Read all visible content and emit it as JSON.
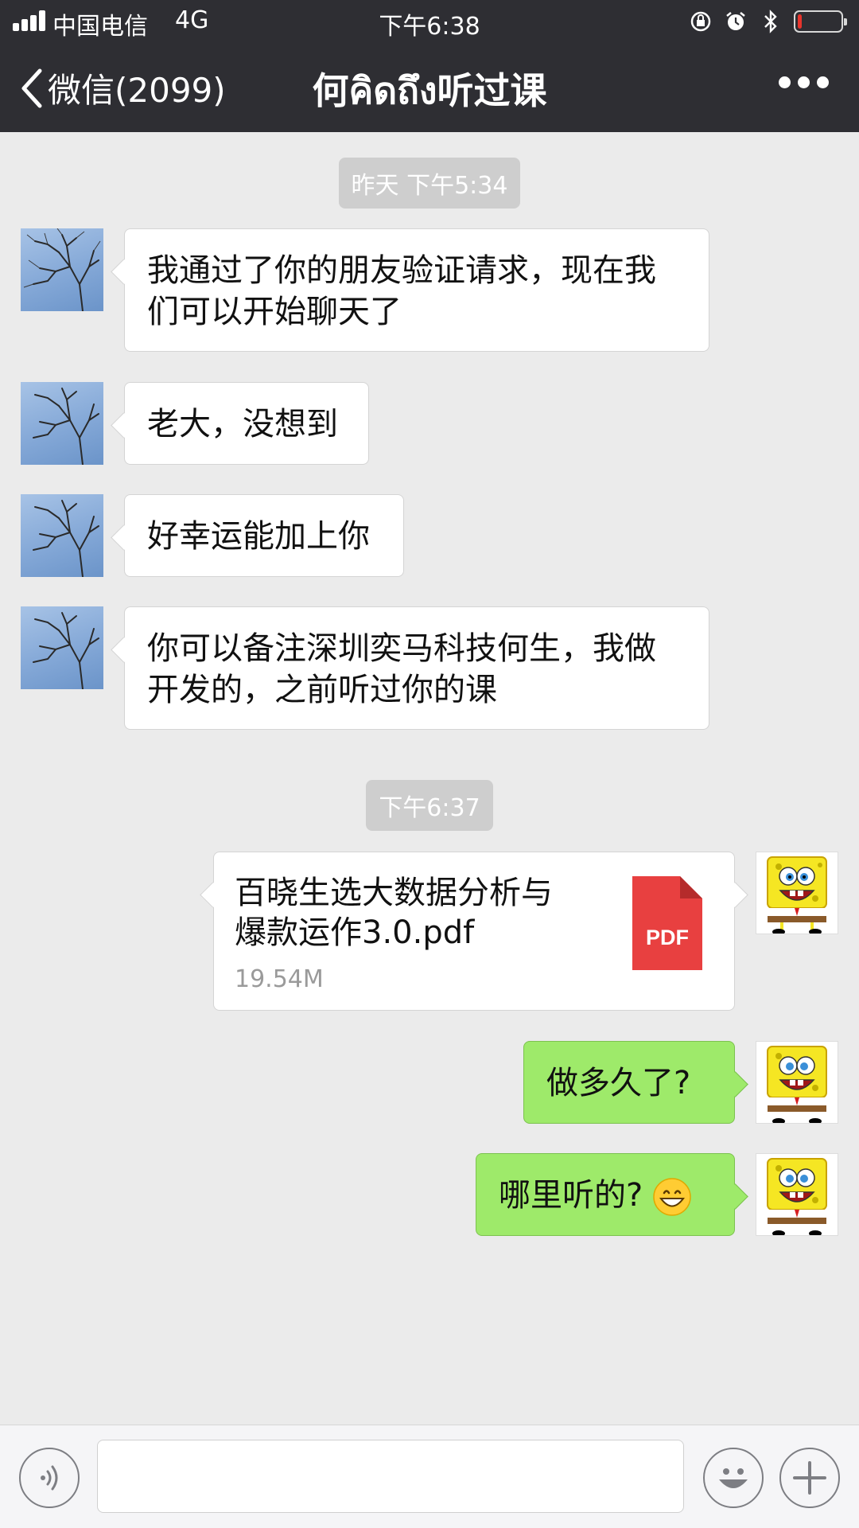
{
  "status_bar": {
    "carrier": "中国电信",
    "network": "4G",
    "time": "下午6:38",
    "icons": [
      "signal-icon",
      "orientation-lock-icon",
      "alarm-icon",
      "bluetooth-icon",
      "battery-icon"
    ],
    "battery_level_percent": 10,
    "battery_color": "#e8342c"
  },
  "header": {
    "back_label": "微信(2099)",
    "title": "何คิดถึง听过课",
    "more_icon": "more-dots-icon",
    "background": "#2e2e33"
  },
  "messages": {
    "ts1": "昨天 下午5:34",
    "in1_line1": "我通过了你的朋友验证请求，现在我",
    "in1_line2": "们可以开始聊天了",
    "in2": "老大，没想到",
    "in3": "好幸运能加上你",
    "in4_line1": "你可以备注深圳奕马科技何生，我做",
    "in4_line2": "开发的，之前听过你的课",
    "ts2": "下午6:37",
    "file": {
      "name_line1": "百晓生选大数据分析与",
      "name_line2": "爆款运作3.0.pdf",
      "size": "19.54M",
      "icon_label": "PDF",
      "icon_color": "#e84040"
    },
    "out1": "做多久了?",
    "out2": "哪里听的?",
    "out2_emoji": "grinning-face-emoji"
  },
  "colors": {
    "outgoing_bubble": "#9eea6a",
    "incoming_bubble": "#ffffff",
    "chat_background": "#ebebeb"
  },
  "input_bar": {
    "voice_icon": "voice-icon",
    "emoji_icon": "emoji-icon",
    "plus_icon": "plus-icon",
    "text_value": ""
  }
}
